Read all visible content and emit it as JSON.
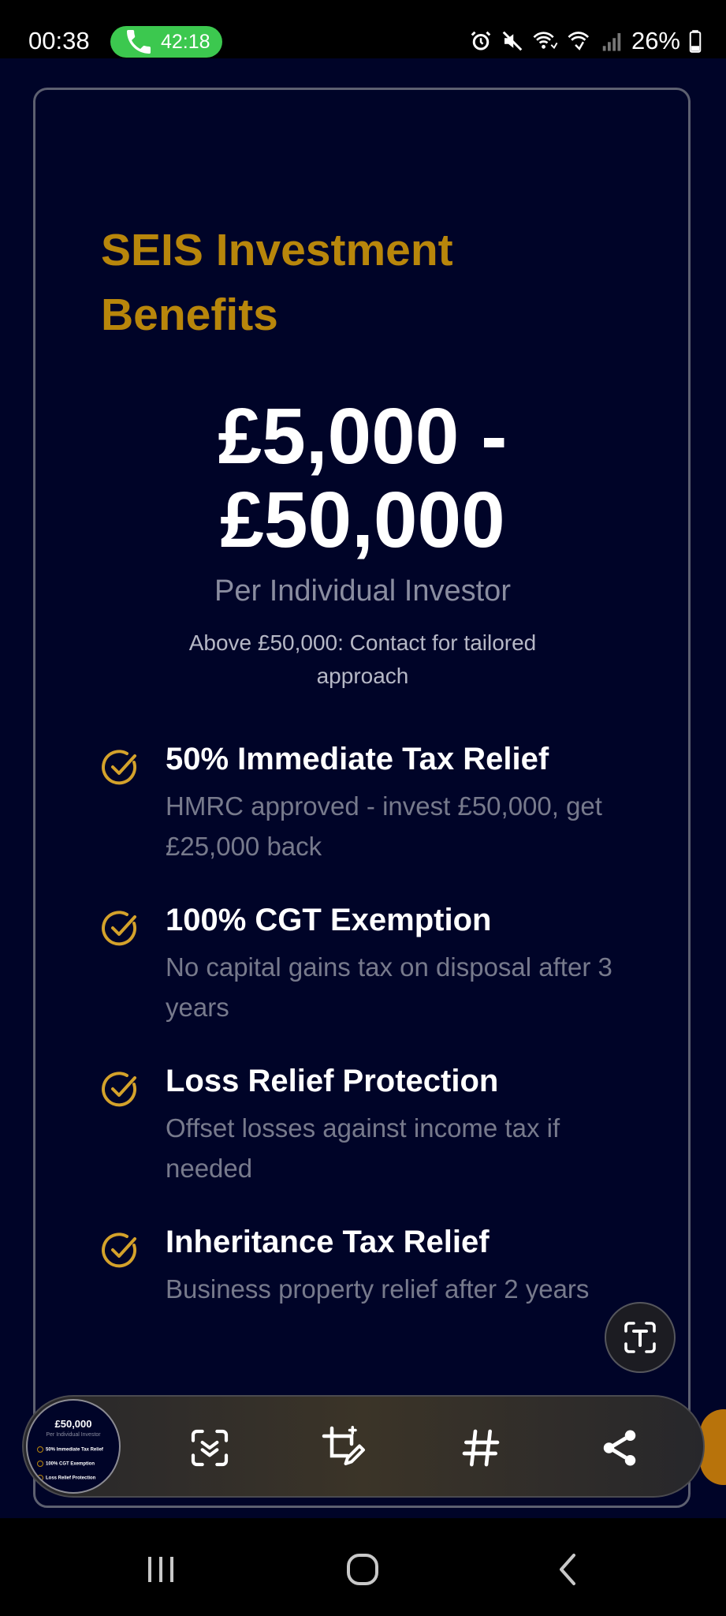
{
  "status_bar": {
    "time": "00:38",
    "call_duration": "42:18",
    "battery": "26%",
    "icons": [
      "phone-icon",
      "alarm-icon",
      "mute-icon",
      "wifi-calling-icon",
      "wifi-icon",
      "signal-icon",
      "battery-icon"
    ]
  },
  "card": {
    "title": "SEIS Investment Benefits",
    "price": "£5,000 - £50,000",
    "per": "Per Individual Investor",
    "above_note": "Above £50,000: Contact for tailored approach",
    "benefits": [
      {
        "title": "50% Immediate Tax Relief",
        "desc": "HMRC approved - invest £50,000, get £25,000 back"
      },
      {
        "title": "100% CGT Exemption",
        "desc": "No capital gains tax on disposal after 3 years"
      },
      {
        "title": "Loss Relief Protection",
        "desc": "Offset losses against income tax if needed"
      },
      {
        "title": "Inheritance Tax Relief",
        "desc": "Business property relief after 2 years"
      }
    ]
  },
  "toolbar": {
    "thumbnail": {
      "price": "£50,000",
      "per": "Per Individual Investor",
      "rows": [
        "50% Immediate Tax Relief",
        "100% CGT Exemption",
        "Loss Relief Protection"
      ]
    },
    "buttons": [
      "scan-text-icon",
      "edit-crop-icon",
      "hashtag-icon",
      "share-icon"
    ]
  },
  "colors": {
    "background": "#000428",
    "gold": "#b8860b",
    "card_border": "#5d6070",
    "muted_text": "#777a8c",
    "call_green": "#3cc84f"
  }
}
